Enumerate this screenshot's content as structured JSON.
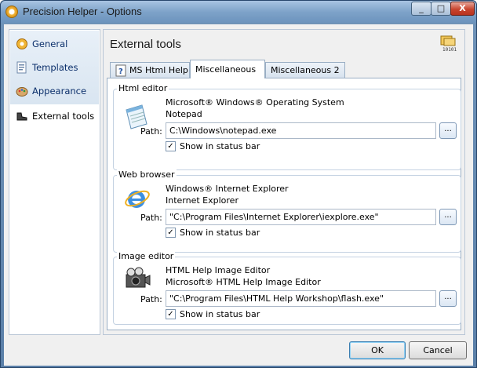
{
  "window": {
    "title": "Precision Helper - Options"
  },
  "titlebar": {
    "minimize": "_",
    "maximize": "□",
    "close": "X"
  },
  "sidebar": {
    "items": [
      {
        "label": "General",
        "icon": "gear-icon"
      },
      {
        "label": "Templates",
        "icon": "templates-icon"
      },
      {
        "label": "Appearance",
        "icon": "palette-icon"
      },
      {
        "label": "External tools",
        "icon": "shoe-icon",
        "selected": true
      }
    ]
  },
  "main": {
    "title": "External tools",
    "tabs": [
      {
        "label": "MS Html Help"
      },
      {
        "label": "Miscellaneous",
        "active": true
      },
      {
        "label": "Miscellaneous 2"
      }
    ]
  },
  "groups": [
    {
      "label": "Html editor",
      "name1": "Microsoft® Windows® Operating System",
      "name2": "Notepad",
      "path_label": "Path:",
      "path": "C:\\Windows\\notepad.exe",
      "browse": "...",
      "show_label": "Show in status bar",
      "show_checked": true,
      "icon": "notepad-icon"
    },
    {
      "label": "Web browser",
      "name1": "Windows® Internet Explorer",
      "name2": "Internet Explorer",
      "path_label": "Path:",
      "path": "\"C:\\Program Files\\Internet Explorer\\iexplore.exe\"",
      "browse": "...",
      "show_label": "Show in status bar",
      "show_checked": true,
      "icon": "internet-explorer-icon"
    },
    {
      "label": "Image editor",
      "name1": "HTML Help Image Editor",
      "name2": "Microsoft® HTML Help Image Editor",
      "path_label": "Path:",
      "path": "\"C:\\Program Files\\HTML Help Workshop\\flash.exe\"",
      "browse": "...",
      "show_label": "Show in status bar",
      "show_checked": true,
      "icon": "camera-icon"
    }
  ],
  "buttons": {
    "ok": "OK",
    "cancel": "Cancel"
  },
  "colors": {
    "accent": "#3c7fb1",
    "titlebar": "#7ea3c9",
    "close": "#c8452f"
  }
}
